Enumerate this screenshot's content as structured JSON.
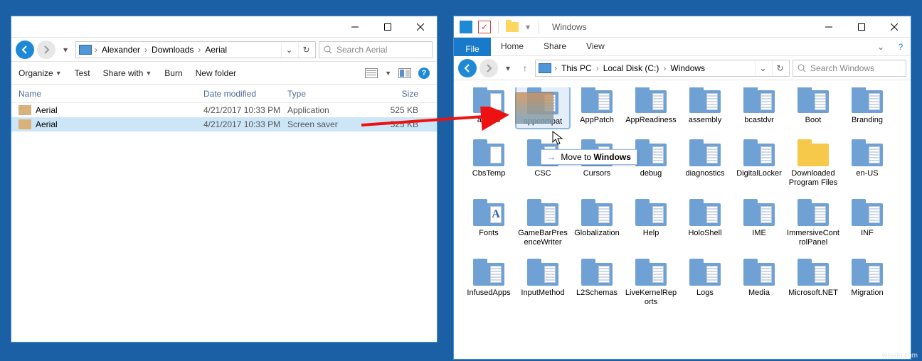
{
  "left": {
    "breadcrumbs": [
      "Alexander",
      "Downloads",
      "Aerial"
    ],
    "search_placeholder": "Search Aerial",
    "cmds": {
      "organize": "Organize",
      "test": "Test",
      "share": "Share with",
      "burn": "Burn",
      "newfolder": "New folder"
    },
    "cols": {
      "name": "Name",
      "date": "Date modified",
      "type": "Type",
      "size": "Size"
    },
    "rows": [
      {
        "name": "Aerial",
        "date": "4/21/2017 10:33 PM",
        "type": "Application",
        "size": "525 KB",
        "selected": false
      },
      {
        "name": "Aerial",
        "date": "4/21/2017 10:33 PM",
        "type": "Screen saver",
        "size": "525 KB",
        "selected": true
      }
    ]
  },
  "right": {
    "title": "Windows",
    "tabs": {
      "file": "File",
      "home": "Home",
      "share": "Share",
      "view": "View"
    },
    "breadcrumbs": [
      "This PC",
      "Local Disk (C:)",
      "Windows"
    ],
    "search_placeholder": "Search Windows",
    "folders": [
      "addins",
      "appcompat",
      "AppPatch",
      "AppReadiness",
      "assembly",
      "bcastdvr",
      "Boot",
      "Branding",
      "CbsTemp",
      "CSC",
      "Cursors",
      "debug",
      "diagnostics",
      "DigitalLocker",
      "Downloaded Program Files",
      "en-US",
      "Fonts",
      "GameBarPresenceWriter",
      "Globalization",
      "Help",
      "HoloShell",
      "IME",
      "ImmersiveControlPanel",
      "INF",
      "InfusedApps",
      "InputMethod",
      "L2Schemas",
      "LiveKernelReports",
      "Logs",
      "Media",
      "Microsoft.NET",
      "Migration"
    ],
    "drag_tip_prefix": "Move to ",
    "drag_tip_target": "Windows"
  },
  "watermark": "wsxdn.com"
}
